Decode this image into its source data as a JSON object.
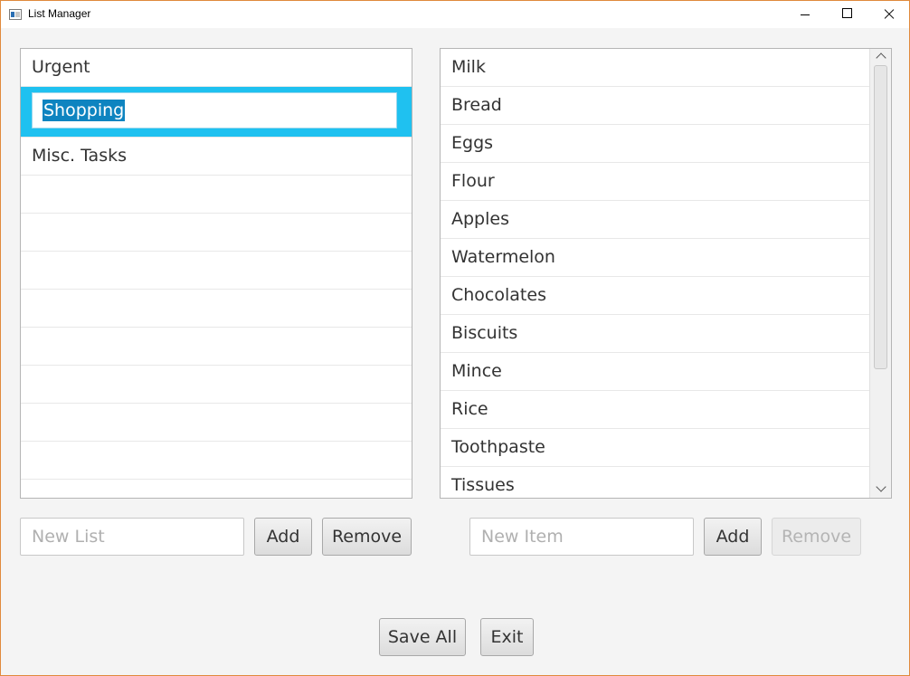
{
  "window": {
    "title": "List Manager"
  },
  "lists": {
    "items": [
      "Urgent",
      "Shopping",
      "Misc. Tasks"
    ],
    "editing_value": "Shopping"
  },
  "list_items": {
    "items": [
      "Milk",
      "Bread",
      "Eggs",
      "Flour",
      "Apples",
      "Watermelon",
      "Chocolates",
      "Biscuits",
      "Mince",
      "Rice",
      "Toothpaste",
      "Tissues"
    ]
  },
  "list_controls": {
    "new_list_placeholder": "New List",
    "add_label": "Add",
    "remove_label": "Remove"
  },
  "item_controls": {
    "new_item_placeholder": "New Item",
    "add_label": "Add",
    "remove_label": "Remove",
    "remove_disabled": true
  },
  "footer": {
    "save_all_label": "Save All",
    "exit_label": "Exit"
  },
  "colors": {
    "selection": "#1fc1f0",
    "text_highlight": "#0e84c0",
    "window_border": "#e08a3c"
  }
}
